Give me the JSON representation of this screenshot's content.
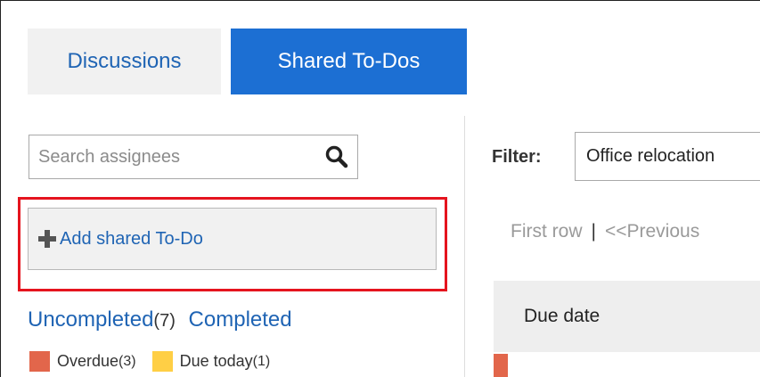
{
  "tabs": [
    {
      "label": "Discussions"
    },
    {
      "label": "Shared To-Dos"
    }
  ],
  "search": {
    "placeholder": "Search assignees"
  },
  "add_button": {
    "label": "Add shared To-Do"
  },
  "status": {
    "uncompleted_label": "Uncompleted",
    "uncompleted_count": "(7)",
    "completed_label": "Completed"
  },
  "legend": {
    "overdue_label": "Overdue",
    "overdue_count": "(3)",
    "due_today_label": "Due today",
    "due_today_count": "(1)"
  },
  "filter": {
    "label": "Filter:",
    "value": "Office relocation"
  },
  "pager": {
    "first_row": "First row",
    "separator": "|",
    "previous": "<<Previous"
  },
  "table": {
    "columns": [
      "Due date"
    ]
  },
  "colors": {
    "accent": "#1c6fd3",
    "link": "#1f64b4",
    "highlight_outline": "#e5141e",
    "overdue": "#e2664b",
    "due_today": "#ffcf45"
  }
}
